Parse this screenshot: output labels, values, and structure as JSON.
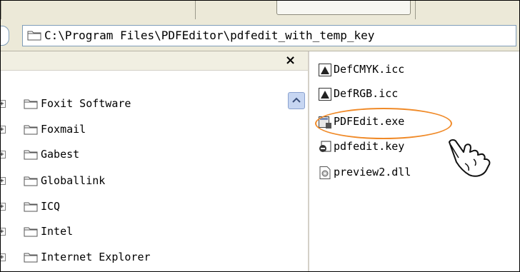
{
  "address": {
    "path": "C:\\Program Files\\PDFEditor\\pdfedit_with_temp_key"
  },
  "folder_pane": {
    "close_glyph": "×",
    "scroll_up_glyph": "▲",
    "items": [
      {
        "label": "Foxit Software",
        "expander": "+"
      },
      {
        "label": "Foxmail",
        "expander": "+"
      },
      {
        "label": "Gabest",
        "expander": "+"
      },
      {
        "label": "Globallink",
        "expander": "+"
      },
      {
        "label": "ICQ",
        "expander": "+"
      },
      {
        "label": "Intel",
        "expander": "+"
      },
      {
        "label": "Internet Explorer",
        "expander": "+"
      }
    ]
  },
  "file_pane": {
    "files": [
      {
        "name": "DefCMYK.icc",
        "icon": "icc-profile-icon"
      },
      {
        "name": "DefRGB.icc",
        "icon": "icc-profile-icon"
      },
      {
        "name": "PDFEdit.exe",
        "icon": "exe-icon",
        "highlighted": true
      },
      {
        "name": "pdfedit.key",
        "icon": "key-file-icon"
      },
      {
        "name": "preview2.dll",
        "icon": "dll-icon"
      }
    ]
  },
  "colors": {
    "highlight_ellipse": "#f08a28",
    "address_border": "#7f9db9",
    "toolbar_bg": "#ece9d8"
  }
}
